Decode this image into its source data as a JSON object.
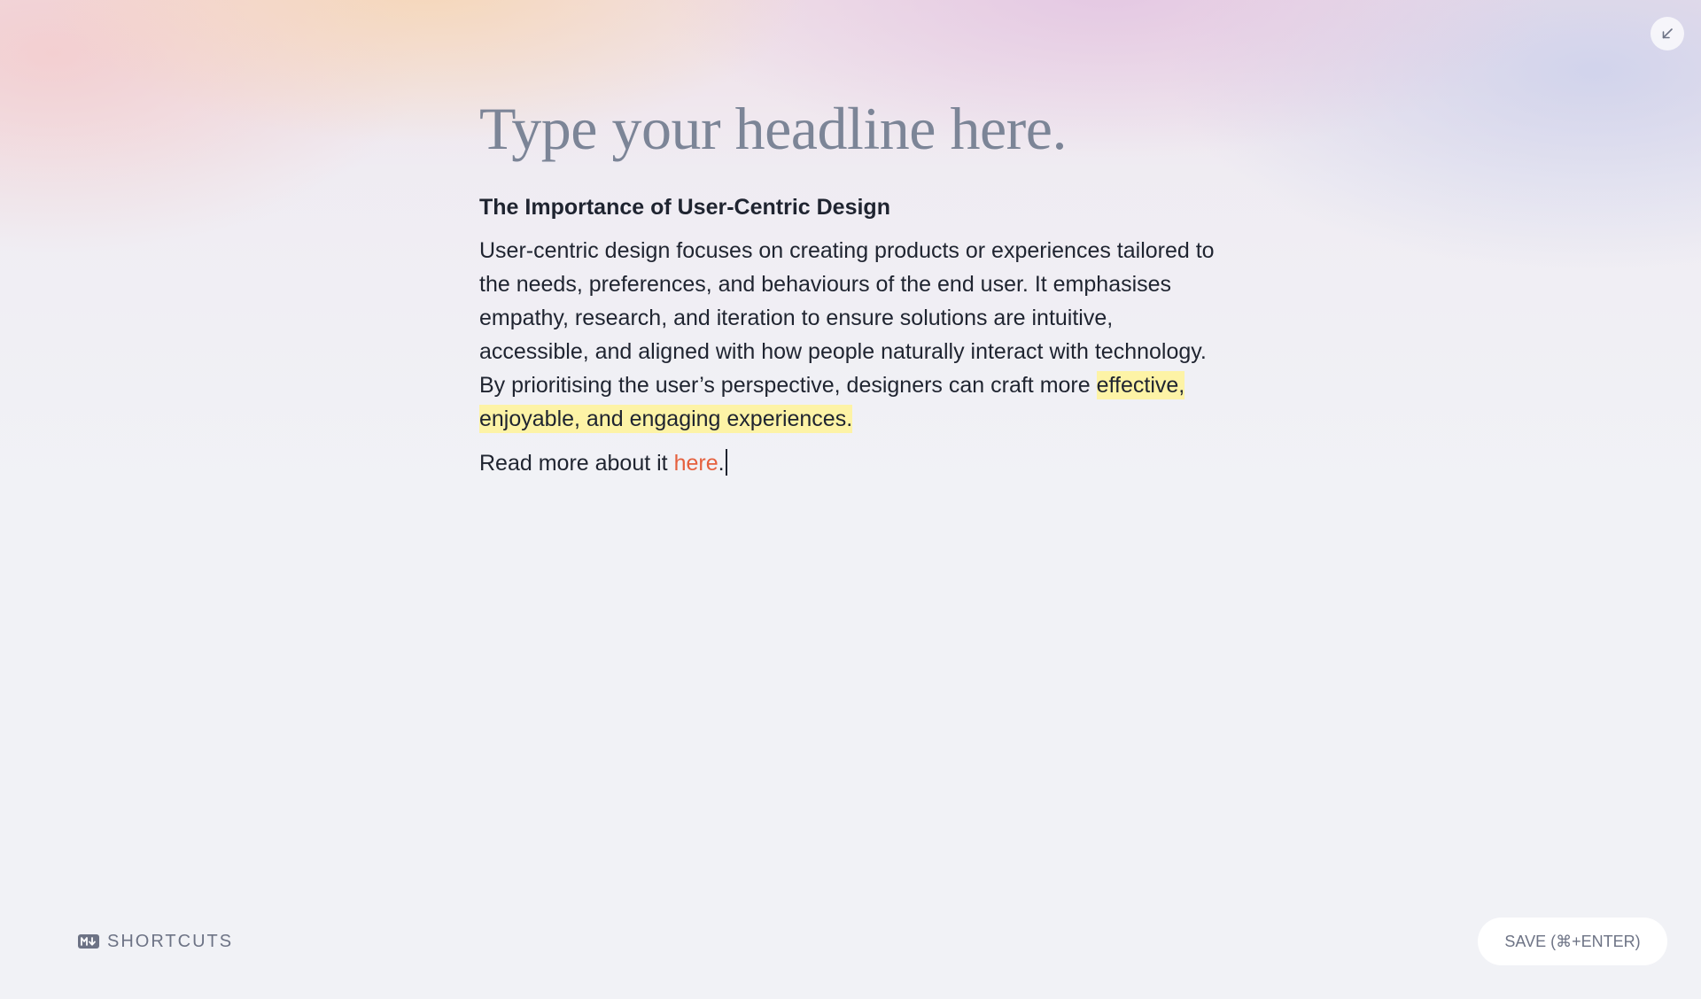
{
  "header": {
    "collapse_icon": "arrow-down-left-icon"
  },
  "editor": {
    "headline_placeholder": "Type your headline here.",
    "section_heading": "The Importance of User-Centric Design",
    "paragraph_text": "User-centric design focuses on creating products or experiences tailored to the needs, preferences, and behaviours of the end user. It emphasises empathy, research, and iteration to ensure solutions are intuitive, accessible, and aligned with how people naturally interact with technology. By prioritising the user’s perspective, designers can craft more",
    "paragraph_highlight": "effective, enjoyable, and engaging experiences.",
    "read_more_prefix": "Read more about it",
    "read_more_link": "here",
    "read_more_suffix": "."
  },
  "footer": {
    "shortcuts_label": "SHORTCUTS",
    "shortcuts_icon": "markdown-icon",
    "save_label": "SAVE (⌘+ENTER)"
  },
  "colors": {
    "link": "#e5603e",
    "highlight": "#fdf3a6",
    "headline_placeholder": "#7c8597",
    "muted": "#6d7385"
  }
}
